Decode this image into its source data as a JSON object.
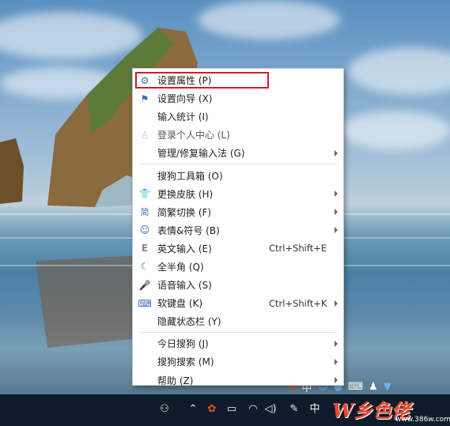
{
  "menu": {
    "groups": [
      [
        {
          "label": "设置属性 (P)",
          "icon": "gear-icon"
        },
        {
          "label": "设置向导 (X)",
          "icon": "flag-icon"
        },
        {
          "label": "输入统计 (I)",
          "icon": ""
        },
        {
          "label": "登录个人中心 (L)",
          "icon": "user-icon",
          "disabled": true
        },
        {
          "label": "管理/修复输入法 (G)",
          "icon": "",
          "submenu": true
        }
      ],
      [
        {
          "label": "搜狗工具箱 (O)",
          "icon": ""
        },
        {
          "label": "更换皮肤 (H)",
          "icon": "shirt-icon",
          "submenu": true
        },
        {
          "label": "简繁切换 (F)",
          "icon": "traditional-char-icon",
          "submenu": true
        },
        {
          "label": "表情&符号 (B)",
          "icon": "smiley-icon",
          "submenu": true
        },
        {
          "label": "英文输入 (E)",
          "icon": "english-e-icon",
          "shortcut": "Ctrl+Shift+E"
        },
        {
          "label": "全半角 (Q)",
          "icon": "moon-icon"
        },
        {
          "label": "语音输入 (S)",
          "icon": "microphone-icon"
        },
        {
          "label": "软键盘 (K)",
          "icon": "keyboard-icon",
          "shortcut": "Ctrl+Shift+K",
          "submenu": true
        },
        {
          "label": "隐藏状态栏 (Y)",
          "icon": ""
        }
      ],
      [
        {
          "label": "今日搜狗 (J)",
          "icon": "",
          "submenu": true
        },
        {
          "label": "搜狗搜索 (M)",
          "icon": "",
          "submenu": true
        },
        {
          "label": "帮助 (Z)",
          "icon": "",
          "submenu": true
        }
      ]
    ]
  },
  "taskbar": {
    "ime_mode": "中",
    "icons": [
      "people-icon",
      "chevron-up-icon",
      "sogou-tray-icon",
      "battery-icon",
      "wifi-icon",
      "volume-icon",
      "pen-icon"
    ]
  },
  "watermark": {
    "text": "W乡色佬",
    "url": "www.386w.com"
  },
  "colors": {
    "highlight_box": "#c8202b",
    "taskbar": "#0d1b2a",
    "icon_blue": "#3b6fbf"
  }
}
